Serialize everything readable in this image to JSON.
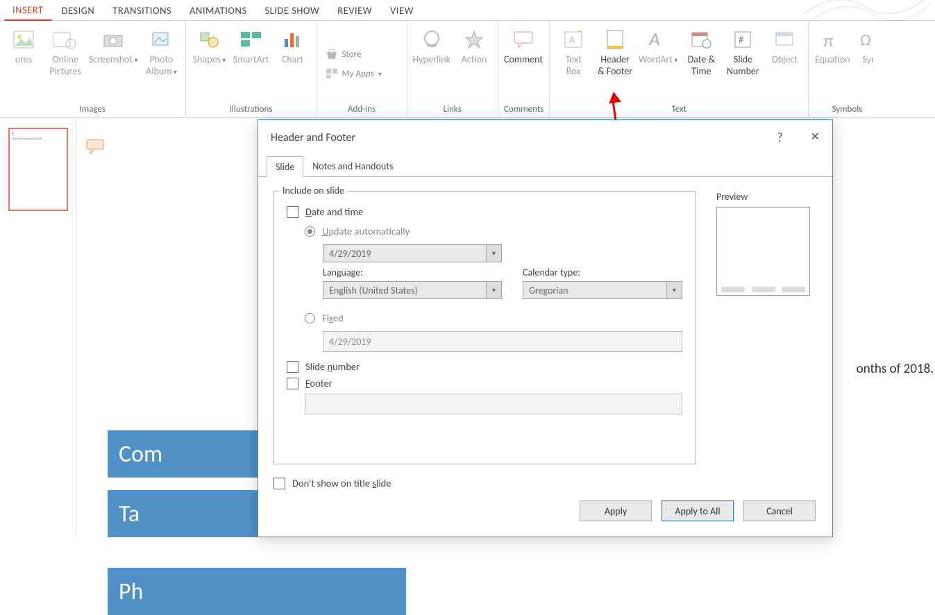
{
  "ribbon": {
    "tabs": [
      "INSERT",
      "DESIGN",
      "TRANSITIONS",
      "ANIMATIONS",
      "SLIDE SHOW",
      "REVIEW",
      "VIEW"
    ],
    "active_tab": "INSERT",
    "groups": {
      "images": {
        "label": "Images",
        "pictures": "ures",
        "online_pictures": "Online\nPictures",
        "screenshot": "Screenshot",
        "photo_album": "Photo\nAlbum"
      },
      "illustrations": {
        "label": "Illustrations",
        "shapes": "Shapes",
        "smartart": "SmartArt",
        "chart": "Chart"
      },
      "addins": {
        "label": "Add-ins",
        "store": "Store",
        "myapps": "My Apps"
      },
      "links": {
        "label": "Links",
        "hyperlink": "Hyperlink",
        "action": "Action"
      },
      "comments": {
        "label": "Comments",
        "comment": "Comment"
      },
      "text": {
        "label": "Text",
        "textbox": "Text\nBox",
        "header_footer": "Header\n& Footer",
        "wordart": "WordArt",
        "date_time": "Date &\nTime",
        "slide_number": "Slide\nNumber",
        "object": "Object"
      },
      "symbols": {
        "label": "Symbols",
        "equation": "Equation",
        "symbol": "Syı"
      }
    }
  },
  "slide": {
    "visible_text": "onths of 2018.",
    "boxes": [
      "Com",
      "Ta",
      "Ph"
    ]
  },
  "dialog": {
    "title": "Header and Footer",
    "help": "?",
    "close": "✕",
    "tabs": {
      "slide": "Slide",
      "notes": "Notes and Handouts"
    },
    "fieldset_label": "Include on slide",
    "date_time": "Date and time",
    "update_auto": "Update automatically",
    "date_value": "4/29/2019",
    "language_label": "Language:",
    "language_value": "English (United States)",
    "calendar_label": "Calendar type:",
    "calendar_value": "Gregorian",
    "fixed": "Fixed",
    "fixed_value": "4/29/2019",
    "slide_number": "Slide number",
    "footer": "Footer",
    "dont_show": "Don't show on title slide",
    "preview": "Preview",
    "apply": "Apply",
    "apply_all": "Apply to All",
    "cancel": "Cancel"
  },
  "thumb_text": "the last 6 months of 2018."
}
